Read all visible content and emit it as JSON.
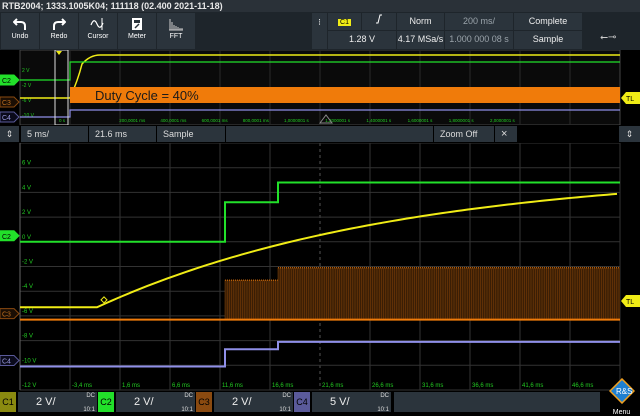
{
  "title": "RTB2004; 1333.1005K04; 111118 (02.400 2021-11-18)",
  "toolbar": [
    {
      "label": "Undo",
      "icon": "undo-icon"
    },
    {
      "label": "Redo",
      "icon": "redo-icon"
    },
    {
      "label": "Cursor",
      "icon": "cursor-icon"
    },
    {
      "label": "Meter",
      "icon": "meter-icon"
    },
    {
      "label": "FFT",
      "icon": "fft-icon"
    }
  ],
  "trigger": {
    "source": "C1",
    "slope": "rising",
    "level": "1.28 V",
    "mode": "Norm",
    "sample_rate": "4.17 MSa/s",
    "timebase": "200 ms/",
    "position": "1.000 000 08 s",
    "acq_state": "Complete",
    "acq_mode": "Sample"
  },
  "overview": {
    "annotation": "Duty Cycle = 40%",
    "y_labels": [
      "2 V",
      "-2 V",
      "-6 V",
      "-10 V"
    ],
    "x_labels": [
      "0 s",
      "200,0001 ms",
      "400,0001 ms",
      "600,0001 ms",
      "800,0001 ms",
      "1,0000001 s",
      "1,2000001 s",
      "1,4000001 s",
      "1,6000001 s",
      "1,8000001 s",
      "2,0000001 s"
    ]
  },
  "zoom": {
    "timebase": "5 ms/",
    "position": "21.6 ms",
    "mode": "Sample",
    "zoom_off": "Zoom Off",
    "close": "×"
  },
  "main": {
    "y_labels": [
      "6 V",
      "4 V",
      "2 V",
      "0 V",
      "-2 V",
      "-4 V",
      "-6 V",
      "-8 V",
      "-10 V",
      "-12 V"
    ],
    "x_labels": [
      "-3,4 ms",
      "1,6 ms",
      "6,6 ms",
      "11,6 ms",
      "16,6 ms",
      "21,6 ms",
      "26,6 ms",
      "31,6 ms",
      "36,6 ms",
      "41,6 ms",
      "46,6 ms"
    ],
    "x_range_ms": [
      -8.4,
      51.6
    ],
    "y_range_V": [
      -12,
      8
    ],
    "trigger_label": "TL"
  },
  "traces": {
    "C2": {
      "color": "#22e02a",
      "steps": [
        [
          -8.4,
          0
        ],
        [
          12.1,
          3.2
        ],
        [
          17.4,
          4.8
        ]
      ]
    },
    "C1": {
      "color": "#f0ec16",
      "flat_V": -5.3,
      "rise_start_ms": -0.7,
      "end_V": 3.9
    },
    "C3": {
      "color": "#f07b0a",
      "base_V": -6.3,
      "pwm": [
        [
          12.1,
          17.4,
          -3.1
        ],
        [
          17.4,
          51.6,
          -2.1
        ]
      ]
    },
    "C4": {
      "color": "#8f8fe8",
      "steps": [
        [
          -8.4,
          -10.1
        ],
        [
          12.1,
          -8.7
        ],
        [
          17.4,
          -8.1
        ]
      ]
    }
  },
  "channels": [
    {
      "name": "C1",
      "scale": "2 V/",
      "coupling": "DC",
      "probe": "10:1",
      "color": "#8a8a10"
    },
    {
      "name": "C2",
      "scale": "2 V/",
      "coupling": "DC",
      "probe": "10:1",
      "color": "#22e02a"
    },
    {
      "name": "C3",
      "scale": "2 V/",
      "coupling": "DC",
      "probe": "10:1",
      "color": "#8a4a10"
    },
    {
      "name": "C4",
      "scale": "5 V/",
      "coupling": "DC",
      "probe": "10:1",
      "color": "#5a5a9a"
    }
  ],
  "menu_label": "Menu",
  "logo_text": "R&S"
}
